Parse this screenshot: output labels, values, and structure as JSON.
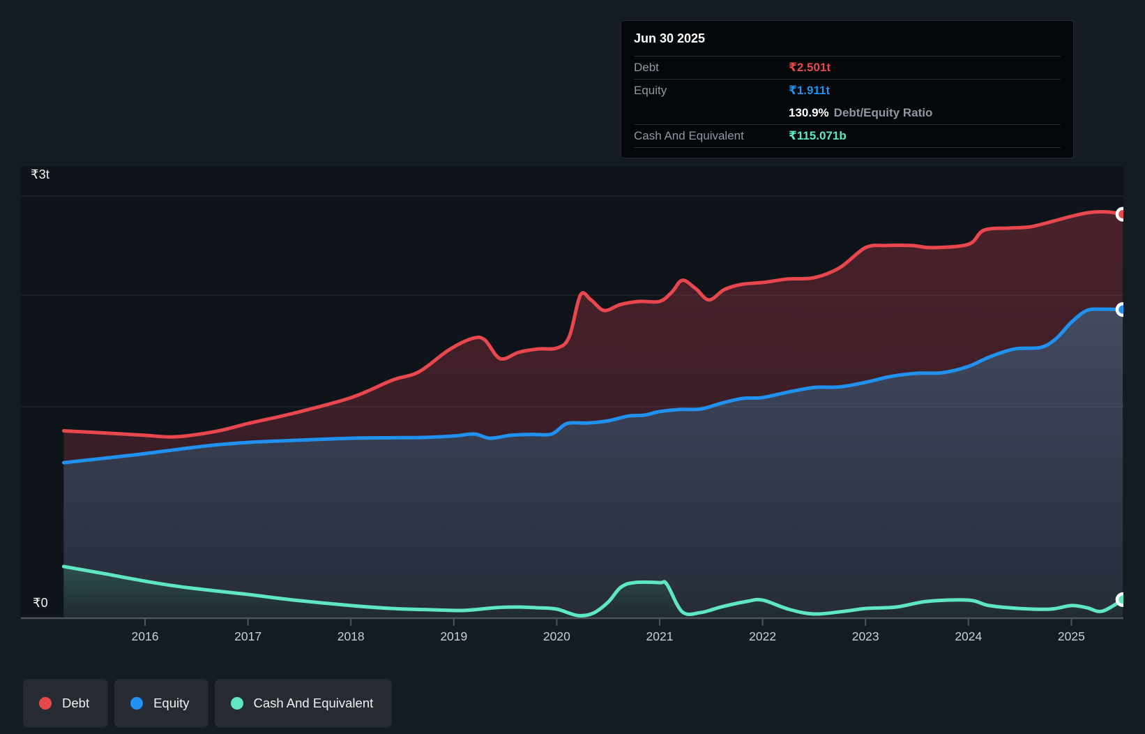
{
  "colors": {
    "debt": "#e8474e",
    "equity": "#2191ef",
    "cash": "#5fe6c2",
    "background": "#151b23",
    "plot_background": "#0f141b",
    "grid_line": "rgba(255,255,255,0.09)",
    "axis_line": "#4d545c",
    "tooltip_background": "#04070a",
    "legend_chip_background": "#262b32",
    "ratio_text": "#ffffff",
    "muted_label": "#8f98a2"
  },
  "tooltip": {
    "date": "Jun 30 2025",
    "debt_label": "Debt",
    "debt_value": "₹2.501t",
    "equity_label": "Equity",
    "equity_value": "₹1.911t",
    "ratio_value": "130.9%",
    "ratio_suffix": "Debt/Equity Ratio",
    "cash_label": "Cash And Equivalent",
    "cash_value": "₹115.071b"
  },
  "legend": {
    "items": [
      {
        "label": "Debt",
        "color_key": "debt"
      },
      {
        "label": "Equity",
        "color_key": "equity"
      },
      {
        "label": "Cash And Equivalent",
        "color_key": "cash"
      }
    ]
  },
  "chart_data": {
    "type": "area",
    "y_unit": "INR trillions",
    "x_unit": "decimal year",
    "x_range": [
      2015.21,
      2025.5
    ],
    "grid": true,
    "legend_position": "bottom-left",
    "y_axis_labels": [
      {
        "label": "₹3t"
      },
      {
        "label": "₹0"
      }
    ],
    "x_tick_labels": [
      "2016",
      "2017",
      "2018",
      "2019",
      "2020",
      "2021",
      "2022",
      "2023",
      "2024",
      "2025"
    ],
    "latest": {
      "date": "Jun 30 2025",
      "debt_t": 2.501,
      "equity_t": 1.911,
      "cash_t": 0.115,
      "debt_equity_ratio_pct": 130.9
    },
    "series": [
      {
        "name": "Debt",
        "color_key": "debt",
        "fill_top": "#4a212a",
        "fill_bottom": "#2e1c25",
        "points": [
          [
            2015.21,
            1.16
          ],
          [
            2015.6,
            1.147
          ],
          [
            2016.0,
            1.132
          ],
          [
            2016.3,
            1.123
          ],
          [
            2016.7,
            1.158
          ],
          [
            2017.0,
            1.205
          ],
          [
            2017.45,
            1.27
          ],
          [
            2018.0,
            1.365
          ],
          [
            2018.4,
            1.473
          ],
          [
            2018.66,
            1.525
          ],
          [
            2018.95,
            1.66
          ],
          [
            2019.18,
            1.732
          ],
          [
            2019.3,
            1.723
          ],
          [
            2019.45,
            1.607
          ],
          [
            2019.63,
            1.646
          ],
          [
            2019.82,
            1.667
          ],
          [
            2020.0,
            1.672
          ],
          [
            2020.12,
            1.74
          ],
          [
            2020.23,
            2.0
          ],
          [
            2020.33,
            1.972
          ],
          [
            2020.46,
            1.905
          ],
          [
            2020.62,
            1.942
          ],
          [
            2020.8,
            1.961
          ],
          [
            2021.0,
            1.961
          ],
          [
            2021.12,
            2.02
          ],
          [
            2021.22,
            2.092
          ],
          [
            2021.35,
            2.04
          ],
          [
            2021.48,
            1.97
          ],
          [
            2021.63,
            2.035
          ],
          [
            2021.8,
            2.067
          ],
          [
            2022.0,
            2.078
          ],
          [
            2022.25,
            2.1
          ],
          [
            2022.5,
            2.108
          ],
          [
            2022.75,
            2.17
          ],
          [
            2023.0,
            2.294
          ],
          [
            2023.2,
            2.307
          ],
          [
            2023.45,
            2.307
          ],
          [
            2023.65,
            2.294
          ],
          [
            2024.0,
            2.315
          ],
          [
            2024.15,
            2.402
          ],
          [
            2024.4,
            2.415
          ],
          [
            2024.6,
            2.423
          ],
          [
            2024.8,
            2.454
          ],
          [
            2025.0,
            2.488
          ],
          [
            2025.18,
            2.512
          ],
          [
            2025.35,
            2.515
          ],
          [
            2025.5,
            2.501
          ]
        ]
      },
      {
        "name": "Equity",
        "color_key": "equity",
        "fill_top": "#434a61",
        "fill_bottom": "#262c39",
        "points": [
          [
            2015.21,
            0.963
          ],
          [
            2015.6,
            0.99
          ],
          [
            2016.0,
            1.019
          ],
          [
            2016.6,
            1.067
          ],
          [
            2017.0,
            1.088
          ],
          [
            2017.5,
            1.102
          ],
          [
            2018.0,
            1.114
          ],
          [
            2018.4,
            1.117
          ],
          [
            2018.7,
            1.119
          ],
          [
            2019.0,
            1.128
          ],
          [
            2019.2,
            1.14
          ],
          [
            2019.35,
            1.114
          ],
          [
            2019.55,
            1.132
          ],
          [
            2019.75,
            1.138
          ],
          [
            2019.95,
            1.14
          ],
          [
            2020.1,
            1.205
          ],
          [
            2020.3,
            1.208
          ],
          [
            2020.5,
            1.222
          ],
          [
            2020.7,
            1.252
          ],
          [
            2020.85,
            1.257
          ],
          [
            2021.0,
            1.279
          ],
          [
            2021.2,
            1.292
          ],
          [
            2021.4,
            1.295
          ],
          [
            2021.6,
            1.331
          ],
          [
            2021.8,
            1.36
          ],
          [
            2022.0,
            1.366
          ],
          [
            2022.25,
            1.4
          ],
          [
            2022.5,
            1.428
          ],
          [
            2022.75,
            1.432
          ],
          [
            2023.0,
            1.46
          ],
          [
            2023.25,
            1.497
          ],
          [
            2023.5,
            1.516
          ],
          [
            2023.75,
            1.52
          ],
          [
            2024.0,
            1.559
          ],
          [
            2024.2,
            1.616
          ],
          [
            2024.45,
            1.667
          ],
          [
            2024.7,
            1.676
          ],
          [
            2024.85,
            1.73
          ],
          [
            2025.0,
            1.832
          ],
          [
            2025.15,
            1.905
          ],
          [
            2025.3,
            1.913
          ],
          [
            2025.5,
            1.911
          ]
        ]
      },
      {
        "name": "Cash And Equivalent",
        "color_key": "cash",
        "fill_top": "#2d4f4c",
        "fill_bottom": "#1f2930",
        "points": [
          [
            2015.21,
            0.32
          ],
          [
            2015.6,
            0.276
          ],
          [
            2016.0,
            0.229
          ],
          [
            2016.4,
            0.19
          ],
          [
            2017.0,
            0.147
          ],
          [
            2017.45,
            0.112
          ],
          [
            2018.0,
            0.078
          ],
          [
            2018.4,
            0.06
          ],
          [
            2018.8,
            0.052
          ],
          [
            2019.1,
            0.048
          ],
          [
            2019.4,
            0.065
          ],
          [
            2019.6,
            0.069
          ],
          [
            2019.8,
            0.065
          ],
          [
            2020.0,
            0.056
          ],
          [
            2020.2,
            0.017
          ],
          [
            2020.35,
            0.03
          ],
          [
            2020.5,
            0.1
          ],
          [
            2020.62,
            0.19
          ],
          [
            2020.75,
            0.22
          ],
          [
            2021.0,
            0.22
          ],
          [
            2021.07,
            0.21
          ],
          [
            2021.22,
            0.039
          ],
          [
            2021.4,
            0.035
          ],
          [
            2021.6,
            0.07
          ],
          [
            2021.85,
            0.104
          ],
          [
            2022.0,
            0.112
          ],
          [
            2022.25,
            0.056
          ],
          [
            2022.5,
            0.026
          ],
          [
            2022.8,
            0.043
          ],
          [
            2023.0,
            0.06
          ],
          [
            2023.3,
            0.069
          ],
          [
            2023.6,
            0.104
          ],
          [
            2024.0,
            0.112
          ],
          [
            2024.2,
            0.078
          ],
          [
            2024.5,
            0.06
          ],
          [
            2024.8,
            0.056
          ],
          [
            2025.0,
            0.078
          ],
          [
            2025.15,
            0.065
          ],
          [
            2025.3,
            0.043
          ],
          [
            2025.5,
            0.115
          ]
        ]
      }
    ]
  }
}
